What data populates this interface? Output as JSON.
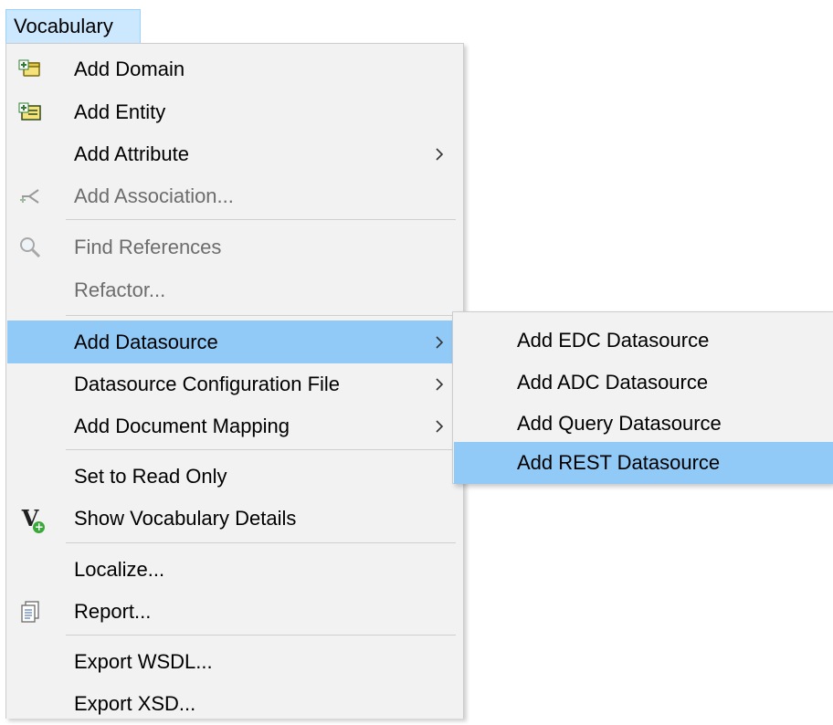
{
  "menubar": {
    "vocabulary_label": "Vocabulary"
  },
  "menu": {
    "items": {
      "add_domain": {
        "label": "Add Domain",
        "icon": "add-domain-icon"
      },
      "add_entity": {
        "label": "Add Entity",
        "icon": "add-entity-icon"
      },
      "add_attribute": {
        "label": "Add Attribute"
      },
      "add_association": {
        "label": "Add Association...",
        "icon": "add-association-icon",
        "disabled": true
      },
      "find_references": {
        "label": "Find References",
        "icon": "magnifier-icon",
        "disabled": true
      },
      "refactor": {
        "label": "Refactor...",
        "disabled": true
      },
      "add_datasource": {
        "label": "Add Datasource",
        "highlighted": true
      },
      "datasource_config": {
        "label": "Datasource Configuration File"
      },
      "add_document_mapping": {
        "label": "Add Document Mapping"
      },
      "set_read_only": {
        "label": "Set to Read Only"
      },
      "show_vocabulary_details": {
        "label": "Show Vocabulary Details",
        "icon": "vocabulary-details-icon"
      },
      "localize": {
        "label": "Localize..."
      },
      "report": {
        "label": "Report...",
        "icon": "report-icon"
      },
      "export_wsdl": {
        "label": "Export WSDL..."
      },
      "export_xsd": {
        "label": "Export XSD..."
      }
    }
  },
  "submenu": {
    "items": {
      "add_edc": {
        "label": "Add EDC Datasource"
      },
      "add_adc": {
        "label": "Add ADC Datasource"
      },
      "add_query": {
        "label": "Add Query Datasource"
      },
      "add_rest": {
        "label": "Add REST Datasource",
        "highlighted": true
      }
    }
  },
  "colors": {
    "menu_bg": "#f2f2f2",
    "highlight": "#91c9f7",
    "menubar_active": "#cce8ff",
    "disabled_text": "#6d6d6d"
  }
}
